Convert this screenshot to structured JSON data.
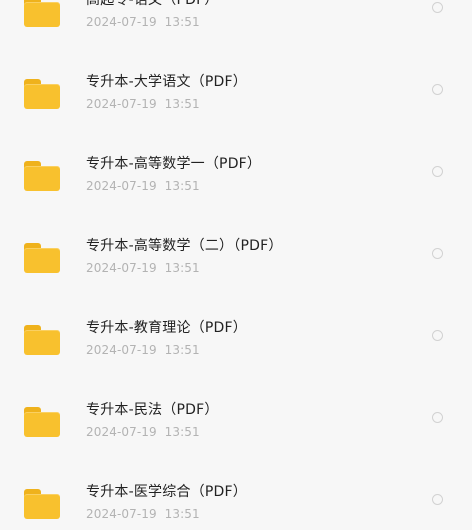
{
  "files": [
    {
      "name": "高起专-语文（PDF）",
      "date": "2024-07-19",
      "time": "13:51"
    },
    {
      "name": "专升本-大学语文（PDF）",
      "date": "2024-07-19",
      "time": "13:51"
    },
    {
      "name": "专升本-高等数学一（PDF）",
      "date": "2024-07-19",
      "time": "13:51"
    },
    {
      "name": "专升本-高等数学（二）（PDF）",
      "date": "2024-07-19",
      "time": "13:51"
    },
    {
      "name": "专升本-教育理论（PDF）",
      "date": "2024-07-19",
      "time": "13:51"
    },
    {
      "name": "专升本-民法（PDF）",
      "date": "2024-07-19",
      "time": "13:51"
    },
    {
      "name": "专升本-医学综合（PDF）",
      "date": "2024-07-19",
      "time": "13:51"
    }
  ],
  "colors": {
    "folder": "#f8c12e",
    "folder_tab": "#efb21c",
    "name_text": "#222222",
    "meta_text": "#b3b3b3",
    "radio": "#d2d2d2",
    "background": "#f7f7f7"
  },
  "icons": {
    "file": "folder-icon",
    "select": "radio-unchecked-icon"
  }
}
